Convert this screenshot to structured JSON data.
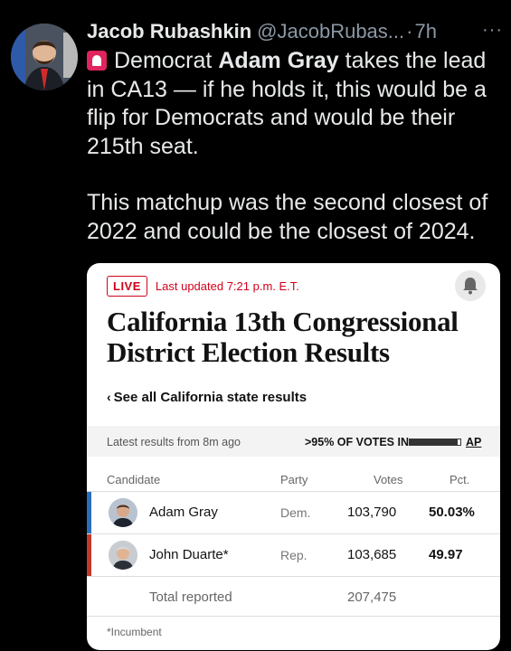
{
  "tweet": {
    "author_name": "Jacob Rubashkin",
    "handle": "@JacobRubas...",
    "dot": "·",
    "time": "7h",
    "more": "···",
    "text_part1": "Democrat ",
    "text_bold": "Adam Gray",
    "text_part2": " takes the lead in CA13 — if he holds it, this would be a flip for Democrats and would be their 215th seat.",
    "text_para2": "This matchup was the second closest of 2022 and could be the closest of 2024."
  },
  "card": {
    "live_label": "LIVE",
    "updated": "Last updated 7:21 p.m. E.T.",
    "headline": "California 13th Congressional District Election Results",
    "see_all": "See all California state results",
    "see_all_chevron": "‹",
    "latest": "Latest results from 8m ago",
    "votes_in": ">95% OF VOTES IN",
    "votes_in_fraction": 0.95,
    "ap": "AP",
    "columns": {
      "candidate": "Candidate",
      "party": "Party",
      "votes": "Votes",
      "pct": "Pct."
    },
    "rows": [
      {
        "name": "Adam Gray",
        "party": "Dem.",
        "votes": "103,790",
        "pct": "50.03%",
        "color": "#2a6ebb"
      },
      {
        "name": "John Duarte*",
        "party": "Rep.",
        "votes": "103,685",
        "pct": "49.97",
        "color": "#c0392b"
      }
    ],
    "total_label": "Total reported",
    "total_votes": "207,475",
    "incumbent_note": "*Incumbent"
  }
}
